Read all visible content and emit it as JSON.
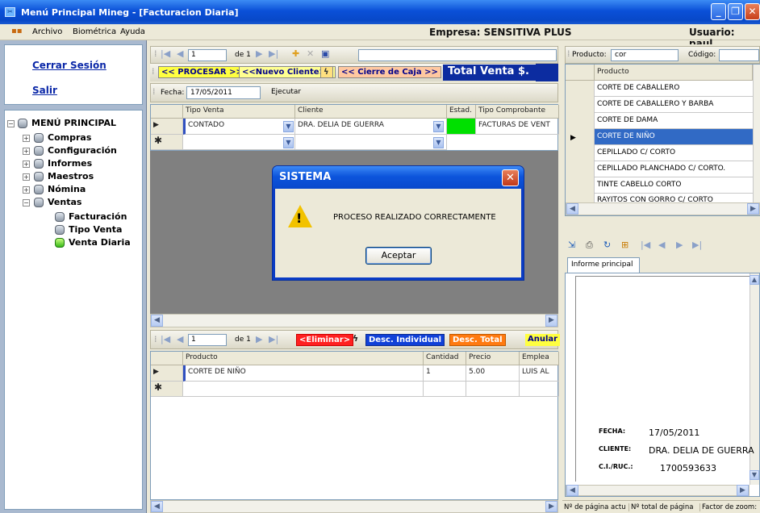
{
  "window": {
    "title": "Menú Principal Mineg - [Facturacion Diaria]"
  },
  "menubar": {
    "items": [
      "Archivo",
      "Biométrica",
      "Ayuda"
    ]
  },
  "header": {
    "empresa": "Empresa: SENSITIVA PLUS",
    "usuario": "Usuario: paul"
  },
  "sidebar": {
    "cerrar_sesion": "Cerrar Sesión",
    "salir": "Salir",
    "tree": {
      "root": "MENÚ PRINCIPAL",
      "items": [
        "Compras",
        "Configuración",
        "Informes",
        "Maestros",
        "Nómina",
        "Ventas"
      ],
      "ventas_children": [
        "Facturación",
        "Tipo Venta",
        "Venta Diaria"
      ]
    }
  },
  "nav_top": {
    "position": "1",
    "of_label": "de 1"
  },
  "actions": {
    "procesar": "<< PROCESAR >>",
    "nuevo_cliente": "<<Nuevo Cliente>>",
    "cierre_caja": "<< Cierre de Caja >>",
    "total_venta": "Total Venta $."
  },
  "filter": {
    "fecha_label": "Fecha:",
    "fecha_value": "17/05/2011",
    "ejecutar": "Ejecutar"
  },
  "ventas_grid": {
    "headers": [
      "Tipo Venta",
      "Cliente",
      "Estad.",
      "Tipo Comprobante"
    ],
    "rows": [
      {
        "tipo_venta": "CONTADO",
        "cliente": "DRA. DELIA DE GUERRA",
        "estado_color": "#00e000",
        "tipo_comprobante": "FACTURAS DE VENT"
      }
    ]
  },
  "dialog": {
    "title": "SISTEMA",
    "message": "PROCESO REALIZADO CORRECTAMENTE",
    "ok": "Aceptar"
  },
  "nav_bottom": {
    "position": "1",
    "of_label": "de 1"
  },
  "detail_actions": {
    "eliminar": "<Eliminar>",
    "desc_individual": "Desc. Individual",
    "desc_total": "Desc. Total",
    "anular": "Anular"
  },
  "detail_grid": {
    "headers": [
      "Producto",
      "Cantidad",
      "Precio",
      "Emplea"
    ],
    "rows": [
      {
        "producto": "CORTE DE NIÑO",
        "cantidad": "1",
        "precio": "5.00",
        "empleado": "LUIS AL"
      }
    ]
  },
  "product_search": {
    "producto_label": "Producto:",
    "producto_value": "cor",
    "codigo_label": "Código:"
  },
  "product_list": {
    "header": "Producto",
    "items": [
      "CORTE DE CABALLERO",
      "CORTE DE CABALLERO Y BARBA",
      "CORTE DE DAMA",
      "CORTE DE NIÑO",
      "CEPILLADO C/ CORTO",
      "CEPILLADO PLANCHADO C/ CORTO.",
      "TINTE CABELLO CORTO",
      "RAYITOS CON GORRO C/ CORTO"
    ],
    "selected_index": 3
  },
  "report": {
    "tab": "Informe principal",
    "fecha_label": "FECHA:",
    "fecha_value": "17/05/2011",
    "cliente_label": "CLIENTE:",
    "cliente_value": "DRA. DELIA DE GUERRA",
    "ruc_label": "C.I./RUC.:",
    "ruc_value": "1700593633"
  },
  "statusbar": {
    "pagina_actual": "Nº de página actu",
    "total_paginas": "Nº total de página",
    "zoom": "Factor de zoom:"
  },
  "colors": {
    "titlebar": "#0a50d8",
    "selection": "#316ac5",
    "status_ok": "#00e000"
  }
}
